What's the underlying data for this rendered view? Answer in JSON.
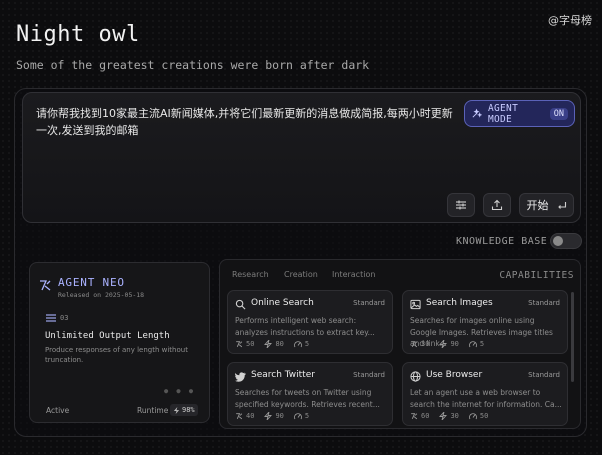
{
  "watermark": "@字母榜",
  "header": {
    "title": "Night owl",
    "subtitle": "Some of the greatest creations were born after dark"
  },
  "prompt": {
    "text": "请你帮我找到10家最主流AI新闻媒体,并将它们最新更新的消息做成简报,每两小时更新一次,发送到我的邮箱",
    "agent_mode_label": "AGENT MODE",
    "agent_mode_state": "ON",
    "start_label": "开始"
  },
  "knowledge_base": {
    "label": "KNOWLEDGE BASE",
    "enabled": false
  },
  "agent": {
    "name": "AGENT NEO",
    "released": "Released on 2025-05-18",
    "feature_number": "03",
    "feature_title": "Unlimited Output Length",
    "feature_desc": "Produce responses of any length without truncation.",
    "status": "Active",
    "runtime_label": "Runtime",
    "runtime_value": "98%"
  },
  "capabilities": {
    "tabs": [
      "Research",
      "Creation",
      "Interaction"
    ],
    "label": "CAPABILITIES",
    "items": [
      {
        "title": "Online Search",
        "badge": "Standard",
        "desc": "Performs intelligent web search: analyzes instructions to extract key...",
        "stats": [
          "50",
          "80",
          "5"
        ],
        "icon": "search-icon"
      },
      {
        "title": "Search Images",
        "badge": "Standard",
        "desc": "Searches for images online using Google Images. Retrieves image titles and link...",
        "stats": [
          "30",
          "90",
          "5"
        ],
        "icon": "image-icon"
      },
      {
        "title": "Search Twitter",
        "badge": "Standard",
        "desc": "Searches for tweets on Twitter using specified keywords. Retrieves recent...",
        "stats": [
          "40",
          "90",
          "5"
        ],
        "icon": "twitter-icon"
      },
      {
        "title": "Use Browser",
        "badge": "Standard",
        "desc": "Let an agent use a web browser to search the internet for information. Ca...",
        "stats": [
          "60",
          "30",
          "50"
        ],
        "icon": "globe-icon"
      }
    ]
  },
  "colors": {
    "accent": "#aab2ff",
    "agent_mode_bg": "#23265a",
    "background": "#0c0c0e"
  }
}
